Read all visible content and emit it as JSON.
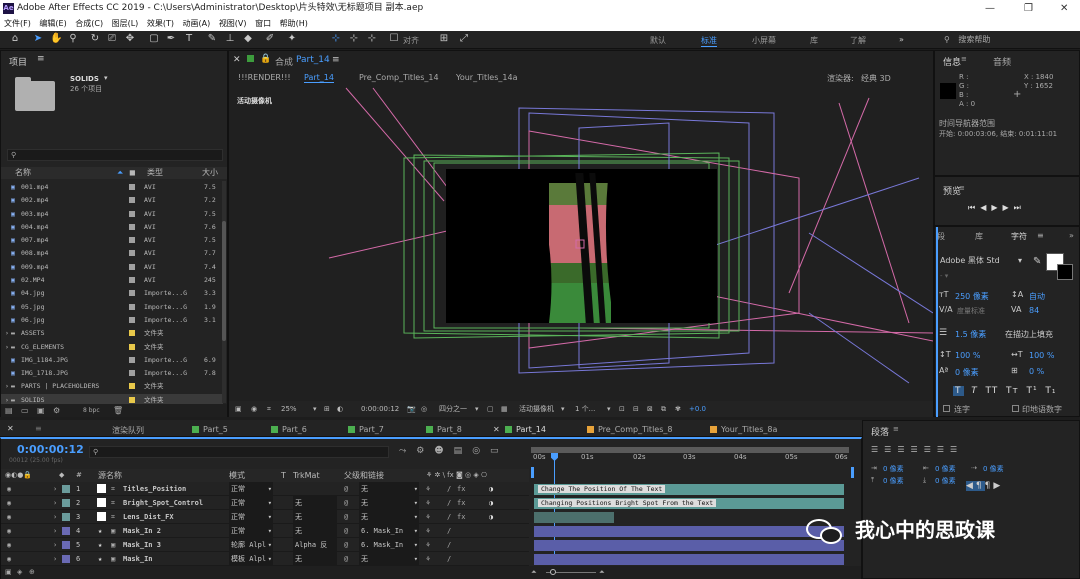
{
  "window": {
    "title": "Adobe After Effects CC 2019 - C:\\Users\\Administrator\\Desktop\\片头特效\\无标题项目 副本.aep"
  },
  "menu": [
    "文件(F)",
    "编辑(E)",
    "合成(C)",
    "图层(L)",
    "效果(T)",
    "动画(A)",
    "视图(V)",
    "窗口",
    "帮助(H)"
  ],
  "workspaces": [
    "默认",
    "标准",
    "小屏幕",
    "库",
    "了解"
  ],
  "search_help": "搜索帮助",
  "toolbar": {
    "align": "对齐"
  },
  "project": {
    "title": "项目",
    "selected_name": "SOLIDS",
    "selected_info": "26 个项目",
    "columns": {
      "name": "名称",
      "type": "类型",
      "size": "大小"
    },
    "items": [
      {
        "name": "001.mp4",
        "type": "AVI",
        "size": "7.5",
        "color": "#a0a0a0"
      },
      {
        "name": "002.mp4",
        "type": "AVI",
        "size": "7.2",
        "color": "#a0a0a0"
      },
      {
        "name": "003.mp4",
        "type": "AVI",
        "size": "7.5",
        "color": "#a0a0a0"
      },
      {
        "name": "004.mp4",
        "type": "AVI",
        "size": "7.6",
        "color": "#a0a0a0"
      },
      {
        "name": "007.mp4",
        "type": "AVI",
        "size": "7.5",
        "color": "#a0a0a0"
      },
      {
        "name": "008.mp4",
        "type": "AVI",
        "size": "7.7",
        "color": "#a0a0a0"
      },
      {
        "name": "009.mp4",
        "type": "AVI",
        "size": "7.4",
        "color": "#a0a0a0"
      },
      {
        "name": "02.MP4",
        "type": "AVI",
        "size": "245",
        "color": "#a0a0a0"
      },
      {
        "name": "04.jpg",
        "type": "Importe...G",
        "size": "3.3",
        "color": "#a0a0a0"
      },
      {
        "name": "05.jpg",
        "type": "Importe...G",
        "size": "1.9",
        "color": "#a0a0a0"
      },
      {
        "name": "06.jpg",
        "type": "Importe...G",
        "size": "3.1",
        "color": "#a0a0a0"
      },
      {
        "name": "ASSETS",
        "type": "文件夹",
        "size": "",
        "color": "#e8c84a"
      },
      {
        "name": "CG_ELEMENTS",
        "type": "文件夹",
        "size": "",
        "color": "#e8c84a"
      },
      {
        "name": "IMG_1184.JPG",
        "type": "Importe...G",
        "size": "6.9",
        "color": "#a0a0a0"
      },
      {
        "name": "IMG_1718.JPG",
        "type": "Importe...G",
        "size": "7.8",
        "color": "#a0a0a0"
      },
      {
        "name": "PARTS | PLACEHOLDERS",
        "type": "文件夹",
        "size": "",
        "color": "#e8c84a"
      },
      {
        "name": "SOLIDS",
        "type": "文件夹",
        "size": "",
        "color": "#e8c84a"
      }
    ],
    "bpc": "8 bpc"
  },
  "comp": {
    "panel_label": "合成",
    "panel_name": "Part_14",
    "breadcrumbs": [
      "!!!RENDER!!!",
      "Part_14",
      "Pre_Comp_Titles_14",
      "Your_Titles_14a"
    ],
    "renderer_label": "渲染器:",
    "renderer": "经典 3D",
    "camera_label": "活动摄像机",
    "zoom": "25%",
    "timecode": "0:00:00:12",
    "resolution": "四分之一",
    "view": "活动摄像机",
    "views": "1 个...",
    "exposure": "+0.0"
  },
  "info": {
    "tabs": [
      "信息",
      "音频"
    ],
    "r": "R :",
    "g": "G :",
    "b": "B :",
    "a": "A : 0",
    "x": "X : 1840",
    "y": "Y : 1652",
    "nav_title": "时间导航器范围",
    "nav_range": "开始: 0:00:03:06, 结束: 0:01:11:01"
  },
  "preview": {
    "title": "预览"
  },
  "character": {
    "tabs": [
      "段",
      "库",
      "字符"
    ],
    "font": "Adobe 黑体 Std",
    "size": "250 像素",
    "leading": "自动",
    "kerning": "度量标准",
    "tracking": "84",
    "stroke": "1.5 像素",
    "stroke_mode": "在描边上填充",
    "vscale": "100 %",
    "hscale": "100 %",
    "baseline": "0 像素",
    "tsume": "0 %",
    "styles": [
      "T",
      "T",
      "TT",
      "Tт",
      "T¹",
      "T₁"
    ],
    "ligature": "连字",
    "hindi": "印地语数字"
  },
  "timeline": {
    "timecode": "0:00:00:12",
    "fps": "00012 (25.00 fps)",
    "tabs": [
      {
        "name": "渲染队列",
        "color": ""
      },
      {
        "name": "Part_5",
        "color": "#4caf50"
      },
      {
        "name": "Part_6",
        "color": "#4caf50"
      },
      {
        "name": "Part_7",
        "color": "#4caf50"
      },
      {
        "name": "Part_8",
        "color": "#4caf50"
      },
      {
        "name": "Part_14",
        "color": "#4caf50"
      },
      {
        "name": "Pre_Comp_Titles_8",
        "color": "#e8a33a"
      },
      {
        "name": "Your_Titles_8a",
        "color": "#e8a33a"
      }
    ],
    "columns": {
      "name": "源名称",
      "mode": "模式",
      "t": "T",
      "trkmat": "TrkMat",
      "parent": "父级和链接"
    },
    "ruler": [
      "00s",
      "01s",
      "02s",
      "03s",
      "04s",
      "05s",
      "06s"
    ],
    "layers": [
      {
        "num": "1",
        "name": "Titles_Position",
        "mode": "正常",
        "trk": "",
        "parent": "无",
        "label": "#6b9c9c",
        "swatch": "#ffffff"
      },
      {
        "num": "2",
        "name": "Bright_Spot_Control",
        "mode": "正常",
        "trk": "无",
        "parent": "无",
        "label": "#6b9c9c",
        "swatch": "#ffffff"
      },
      {
        "num": "3",
        "name": "Lens_Dist_FX",
        "mode": "正常",
        "trk": "无",
        "parent": "无",
        "label": "#6b9c9c",
        "swatch": "#ffffff"
      },
      {
        "num": "4",
        "name": "Mask_In 2",
        "mode": "正常",
        "trk": "无",
        "parent": "6. Mask_In",
        "label": "#6a6ab4",
        "swatch": ""
      },
      {
        "num": "5",
        "name": "Mask_In 3",
        "mode": "轮廓 Alpl",
        "trk": "Alpha 反",
        "parent": "6. Mask_In",
        "label": "#6a6ab4",
        "swatch": ""
      },
      {
        "num": "6",
        "name": "Mask_In",
        "mode": "模板 Alpl",
        "trk": "无",
        "parent": "无",
        "label": "#6a6ab4",
        "swatch": ""
      }
    ],
    "bars": [
      "Change The Position Of The Text",
      "Changing Positions Bright Spot From the Text"
    ]
  },
  "paragraph": {
    "title": "段落",
    "fields": [
      "0 像素",
      "0 像素",
      "0 像素",
      "0 像素",
      "0 像素"
    ]
  },
  "watermark": {
    "text": "我心中的思政课"
  },
  "colors": {
    "accent": "#2d8ceb",
    "teal": "#5b9a96",
    "purple": "#5a5ea8",
    "green": "#4caf50",
    "orange": "#e8a33a"
  }
}
